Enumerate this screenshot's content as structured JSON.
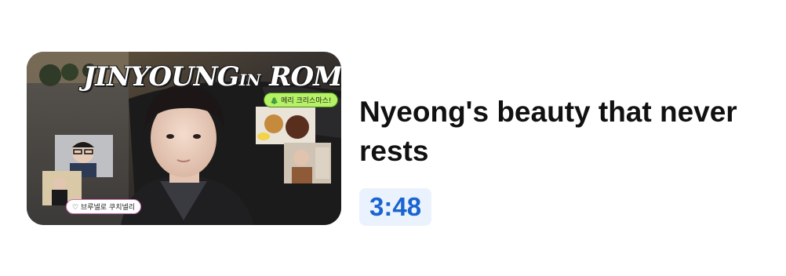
{
  "video": {
    "title": "Nyeong's beauty that never rests",
    "duration": "3:48",
    "accent_color": "#1a64d1",
    "badge_bg": "#eaf2fd"
  },
  "thumbnail": {
    "overlay_title_main": "JINYOUNG",
    "overlay_title_in": "IN",
    "overlay_title_place": "ROME",
    "caption_top": "🎄 메리 크리스마스!",
    "caption_bottom": "♡ 브루넬로 쿠치넬리"
  }
}
